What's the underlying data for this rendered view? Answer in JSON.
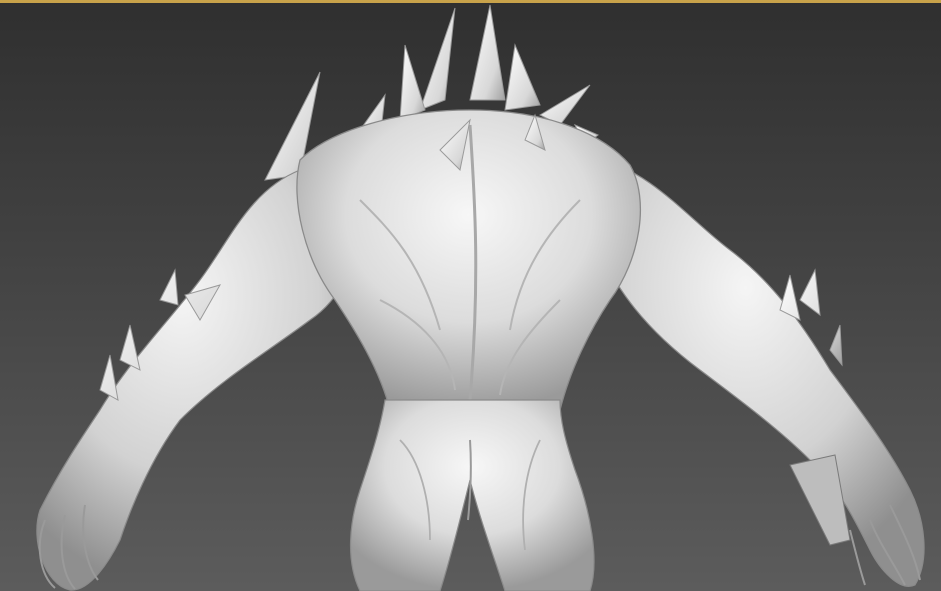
{
  "viewport": {
    "label": "",
    "shading": "matcap-clay",
    "colors": {
      "background_top": "#2f2f2f",
      "background_bottom": "#5c5c5c",
      "accent_border": "#c8a24a",
      "clay_light": "#f2f2f2",
      "clay_mid": "#cfcfcf",
      "clay_shadow": "#8a8a8a",
      "clay_dark": "#3a3a3a"
    }
  },
  "model": {
    "name": "",
    "view": "back"
  }
}
